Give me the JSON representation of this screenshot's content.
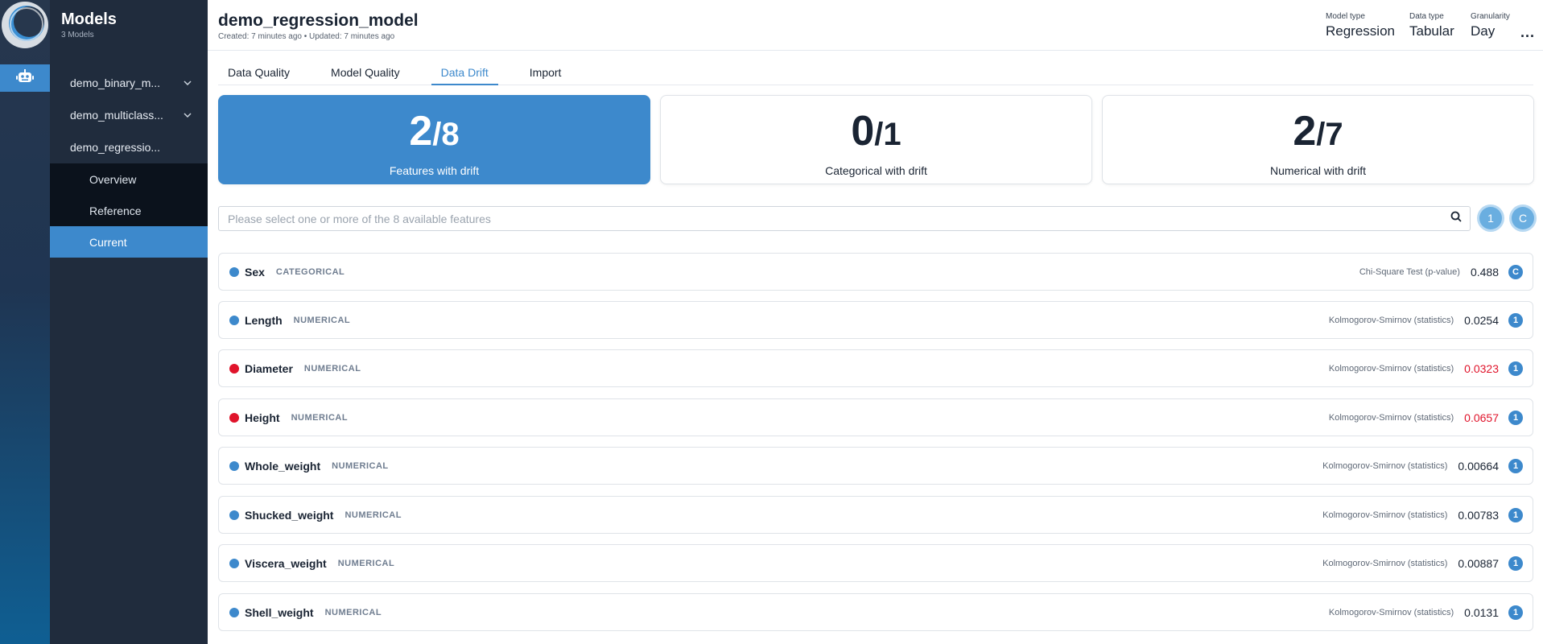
{
  "sidebar": {
    "title": "Models",
    "subtitle": "3 Models",
    "models": [
      {
        "label": "demo_binary_m..."
      },
      {
        "label": "demo_multiclass..."
      },
      {
        "label": "demo_regressio..."
      }
    ],
    "subitems": [
      {
        "label": "Overview"
      },
      {
        "label": "Reference"
      },
      {
        "label": "Current"
      }
    ],
    "active_subitem": "Current"
  },
  "header": {
    "title": "demo_regression_model",
    "meta": "Created: 7 minutes ago • Updated: 7 minutes ago",
    "model_type_label": "Model type",
    "model_type": "Regression",
    "data_type_label": "Data type",
    "data_type": "Tabular",
    "granularity_label": "Granularity",
    "granularity": "Day",
    "more": "..."
  },
  "tabs": [
    {
      "label": "Data Quality"
    },
    {
      "label": "Model Quality"
    },
    {
      "label": "Data Drift"
    },
    {
      "label": "Import"
    }
  ],
  "active_tab": "Data Drift",
  "cards": [
    {
      "num": "2",
      "den": "/8",
      "label": "Features with drift"
    },
    {
      "num": "0",
      "den": "/1",
      "label": "Categorical with drift"
    },
    {
      "num": "2",
      "den": "/7",
      "label": "Numerical with drift"
    }
  ],
  "search": {
    "placeholder": "Please select one or more of the 8 available features"
  },
  "filter_buttons": [
    {
      "label": "1"
    },
    {
      "label": "C"
    }
  ],
  "colors": {
    "accent": "#3d89cc",
    "drift": "#e0142b",
    "ok": "#3d89cc"
  },
  "features": [
    {
      "name": "Sex",
      "type": "CATEGORICAL",
      "test": "Chi-Square Test (p-value)",
      "score": "0.488",
      "drift": false,
      "badge": "C"
    },
    {
      "name": "Length",
      "type": "NUMERICAL",
      "test": "Kolmogorov-Smirnov (statistics)",
      "score": "0.0254",
      "drift": false,
      "badge": "1"
    },
    {
      "name": "Diameter",
      "type": "NUMERICAL",
      "test": "Kolmogorov-Smirnov (statistics)",
      "score": "0.0323",
      "drift": true,
      "badge": "1"
    },
    {
      "name": "Height",
      "type": "NUMERICAL",
      "test": "Kolmogorov-Smirnov (statistics)",
      "score": "0.0657",
      "drift": true,
      "badge": "1"
    },
    {
      "name": "Whole_weight",
      "type": "NUMERICAL",
      "test": "Kolmogorov-Smirnov (statistics)",
      "score": "0.00664",
      "drift": false,
      "badge": "1"
    },
    {
      "name": "Shucked_weight",
      "type": "NUMERICAL",
      "test": "Kolmogorov-Smirnov (statistics)",
      "score": "0.00783",
      "drift": false,
      "badge": "1"
    },
    {
      "name": "Viscera_weight",
      "type": "NUMERICAL",
      "test": "Kolmogorov-Smirnov (statistics)",
      "score": "0.00887",
      "drift": false,
      "badge": "1"
    },
    {
      "name": "Shell_weight",
      "type": "NUMERICAL",
      "test": "Kolmogorov-Smirnov (statistics)",
      "score": "0.0131",
      "drift": false,
      "badge": "1"
    }
  ]
}
